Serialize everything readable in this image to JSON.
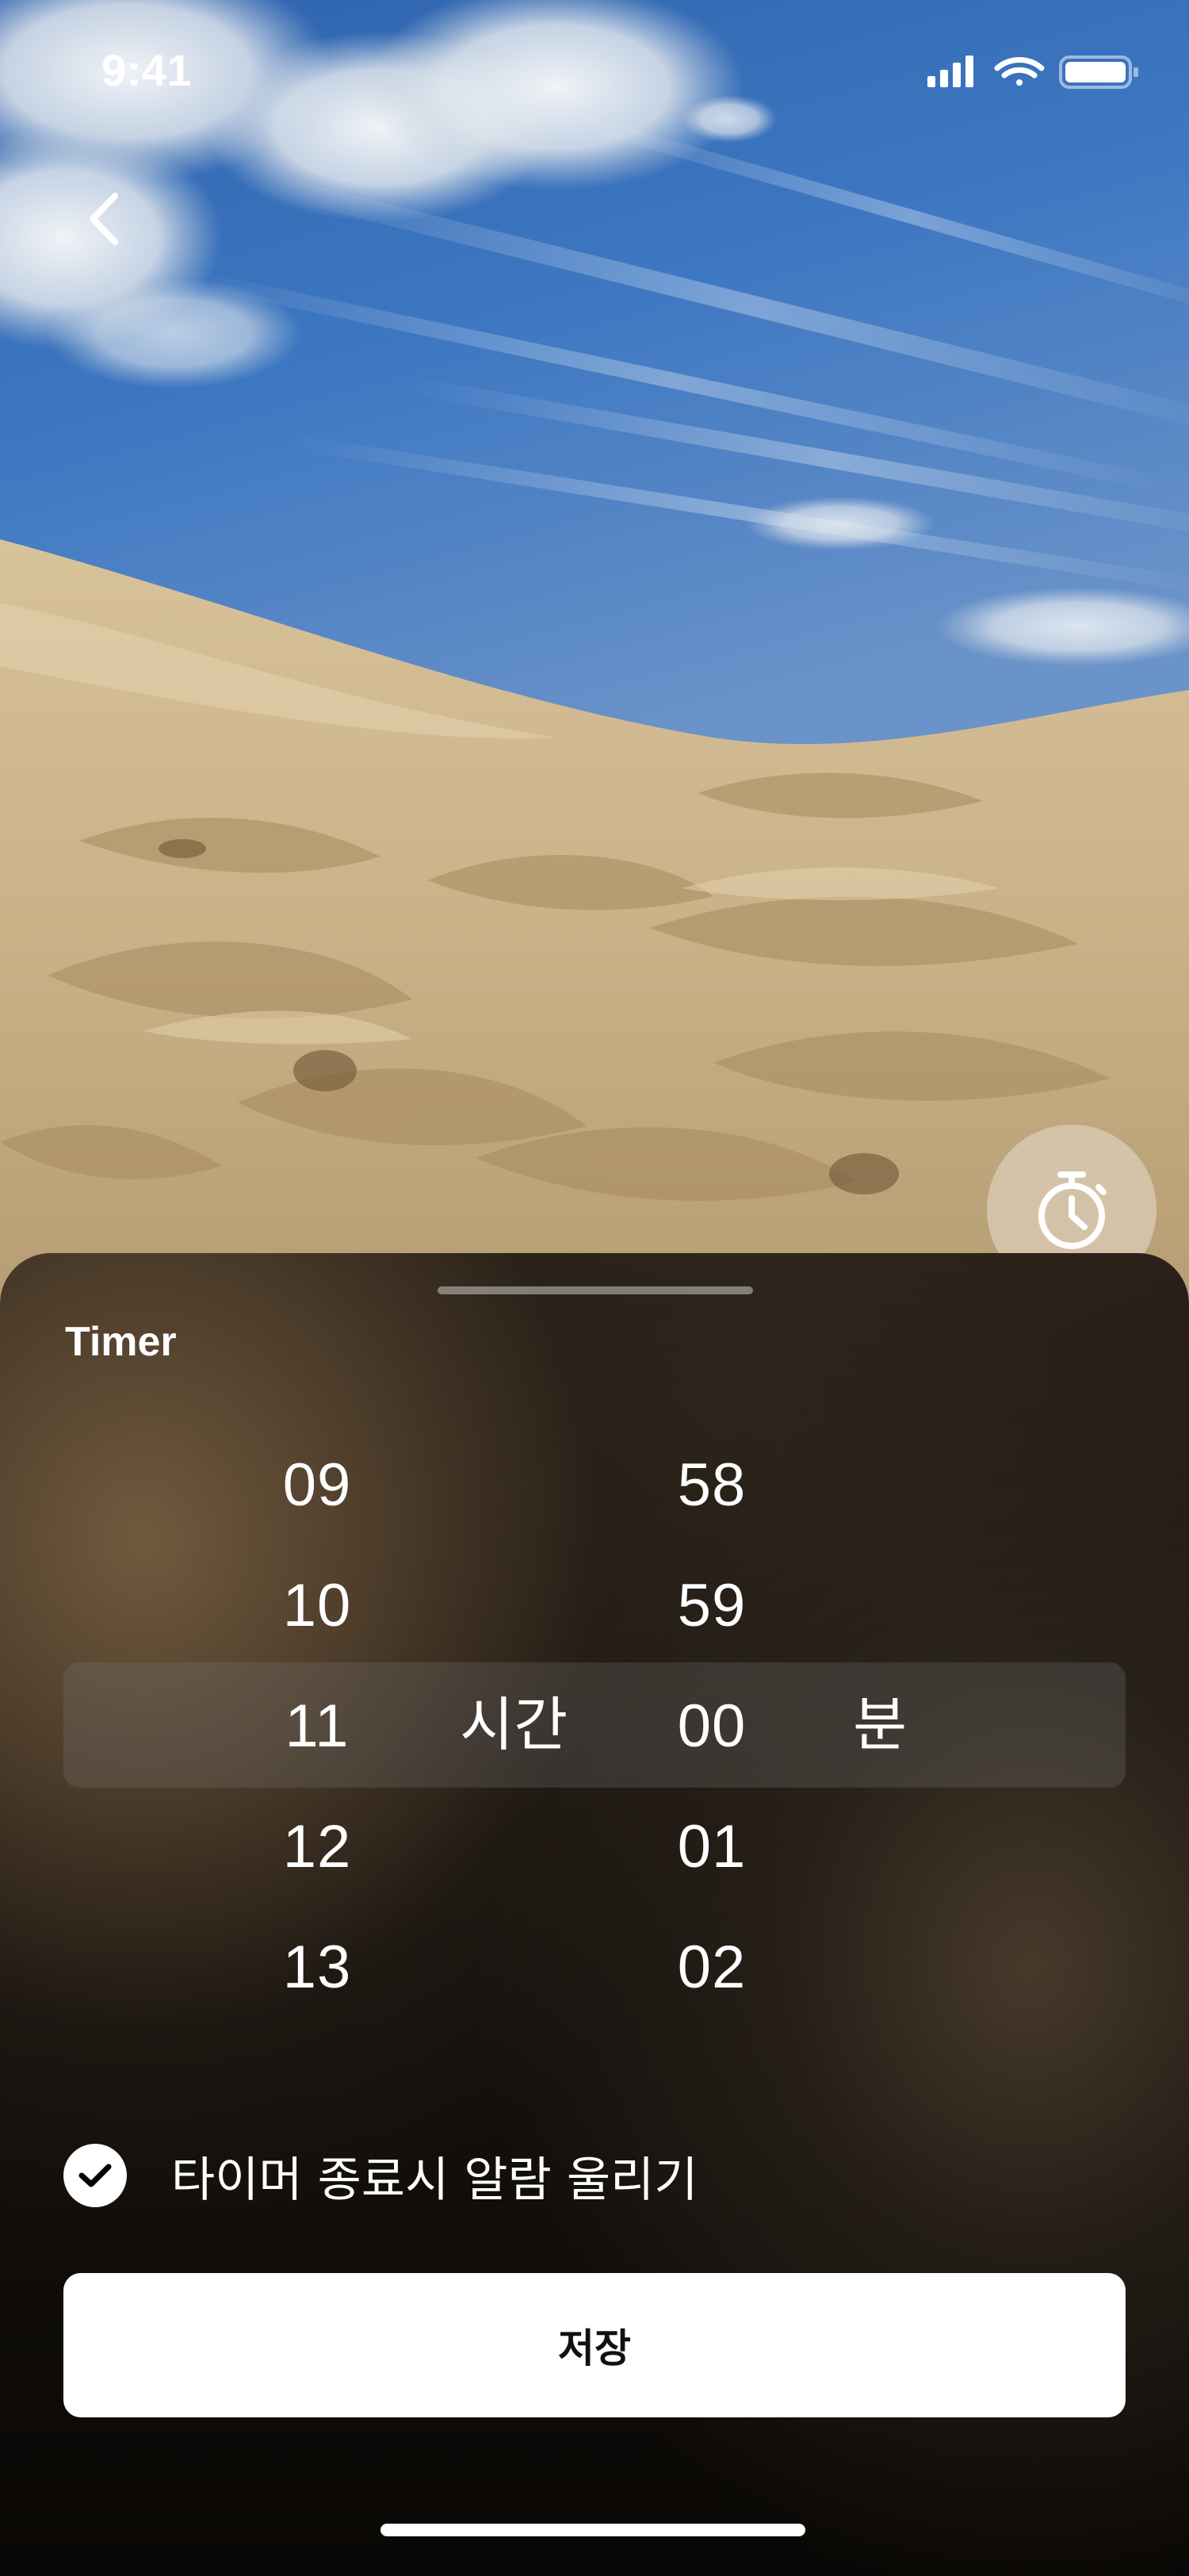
{
  "status_bar": {
    "time": "9:41"
  },
  "navigation": {
    "back_icon": "chevron-left-icon"
  },
  "floating_button": {
    "icon": "stopwatch-icon"
  },
  "sheet": {
    "title": "Timer",
    "picker": {
      "hours": [
        "09",
        "10",
        "11",
        "12",
        "13"
      ],
      "minutes": [
        "58",
        "59",
        "00",
        "01",
        "02"
      ],
      "selected_hour": "11",
      "selected_minute": "00",
      "hour_unit": "시간",
      "minute_unit": "분"
    },
    "alarm_option": {
      "label": "타이머 종료시 알람 울리기",
      "checked": true
    },
    "save_button": {
      "label": "저장"
    }
  },
  "colors": {
    "sheet_text": "#ffffff",
    "save_button_bg": "#ffffff",
    "save_button_text": "#111111"
  }
}
